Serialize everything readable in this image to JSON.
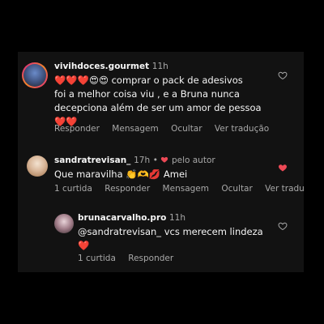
{
  "comments": [
    {
      "username": "vivihdoces.gourmet",
      "time": "11h",
      "line1": "❤️❤️❤️😍😍 comprar o pack de adesivos",
      "line2": "foi a melhor coisa viu , e a Bruna nunca",
      "line3": "decepciona além de ser um amor de pessoa",
      "line4": "❤️❤️",
      "actions": [
        "Responder",
        "Mensagem",
        "Ocultar",
        "Ver tradução"
      ],
      "liked": false
    },
    {
      "username": "sandratrevisan_",
      "time": "17h",
      "author_tag": "pelo autor",
      "text": "Que maravilha 👏🫶💋 Amei",
      "actions": [
        "1 curtida",
        "Responder",
        "Mensagem",
        "Ocultar",
        "Ver tradução"
      ],
      "liked": true
    },
    {
      "username": "brunacarvalho.pro",
      "time": "11h",
      "line1": "@sandratrevisan_ vcs merecem lindeza",
      "line2": "❤️",
      "actions": [
        "1 curtida",
        "Responder"
      ],
      "liked": false
    }
  ],
  "colors": {
    "background": "#121212",
    "text": "#f5f5f5",
    "muted": "#a8a8a8",
    "like_red": "#ed4956"
  },
  "icons": {
    "like": "heart-outline-icon",
    "liked": "heart-filled-icon"
  }
}
